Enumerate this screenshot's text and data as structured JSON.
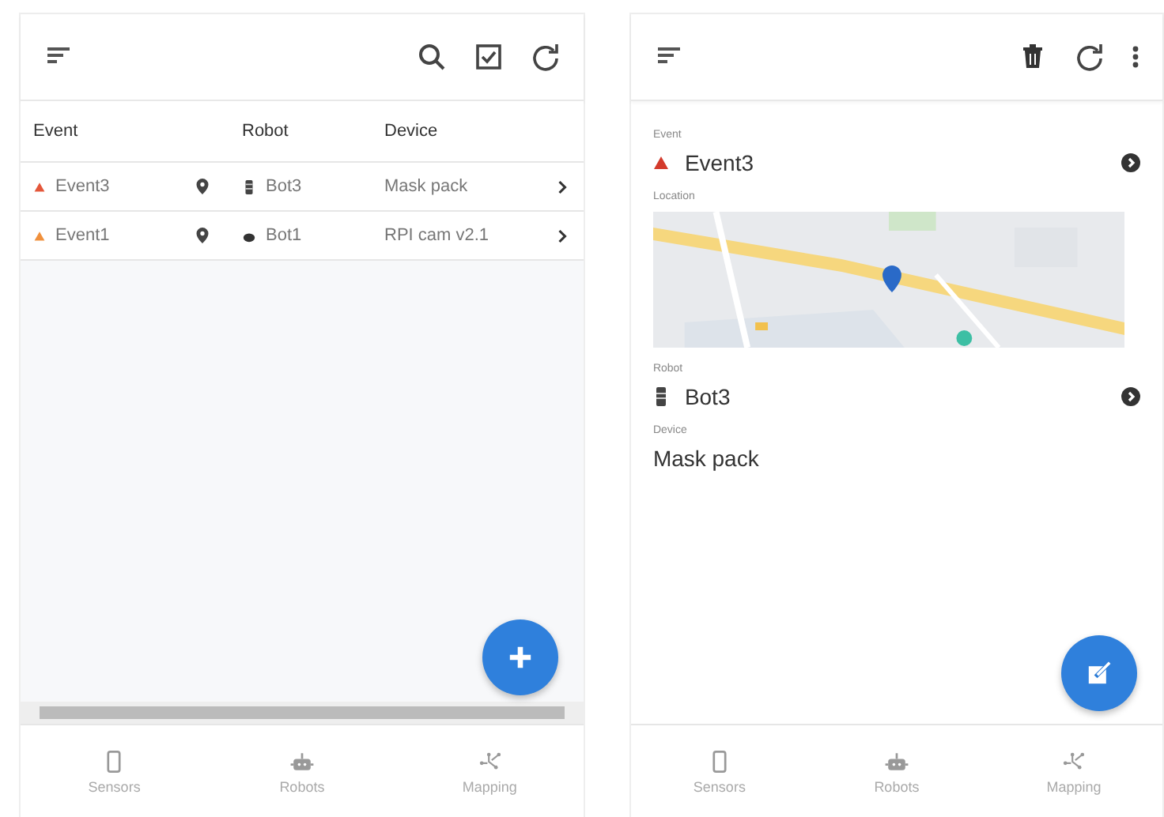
{
  "list_screen": {
    "toolbar": {
      "actions": [
        {
          "kind": "search"
        },
        {
          "kind": "select"
        },
        {
          "kind": "refresh"
        }
      ]
    },
    "table": {
      "columns": [
        "Event",
        "Robot",
        "Device"
      ],
      "rows": [
        {
          "event": {
            "name": "Event3",
            "color": "#e4573a"
          },
          "robot": {
            "name": "Bot3",
            "kind": "canister"
          },
          "device": "Mask pack"
        },
        {
          "event": {
            "name": "Event1",
            "color": "#f0903c"
          },
          "robot": {
            "name": "Bot1",
            "kind": "dome"
          },
          "device": "RPI cam v2.1"
        }
      ]
    },
    "fab": {
      "kind": "add"
    },
    "nav": [
      {
        "label": "Sensors",
        "kind": "sensors"
      },
      {
        "label": "Robots",
        "kind": "robots"
      },
      {
        "label": "Mapping",
        "kind": "mapping"
      }
    ]
  },
  "detail_screen": {
    "toolbar": {
      "actions": [
        {
          "kind": "delete"
        },
        {
          "kind": "refresh"
        },
        {
          "kind": "more"
        }
      ]
    },
    "fields": [
      {
        "kind": "event",
        "label": "Event",
        "value": "Event3",
        "color": "#d33a2c"
      },
      {
        "kind": "map",
        "label": "Location"
      },
      {
        "kind": "robot",
        "label": "Robot",
        "value": "Bot3",
        "icon": {
          "kind": "canister"
        }
      },
      {
        "kind": "text",
        "label": "Device",
        "value": "Mask pack"
      }
    ],
    "fab": {
      "kind": "edit"
    },
    "nav": [
      {
        "label": "Sensors",
        "kind": "sensors"
      },
      {
        "label": "Robots",
        "kind": "robots"
      },
      {
        "label": "Mapping",
        "kind": "mapping"
      }
    ]
  }
}
